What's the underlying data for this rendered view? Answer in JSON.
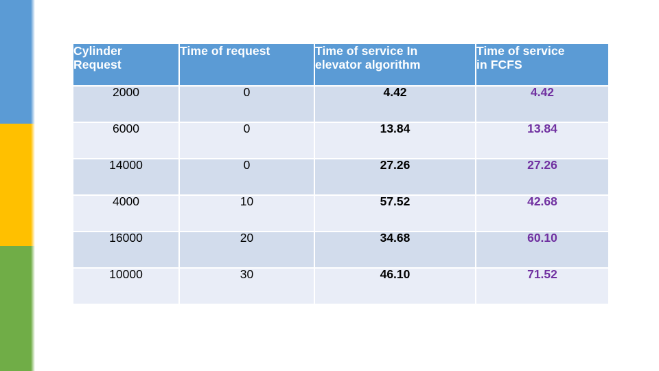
{
  "accent_bar": {
    "segments": [
      {
        "name": "blue-segment",
        "color": "#5B9BD5"
      },
      {
        "name": "yellow-segment",
        "color": "#FFC000"
      },
      {
        "name": "green-segment",
        "color": "#70AD47"
      }
    ]
  },
  "table": {
    "header_bg": "#5B9BD5",
    "header_text_color": "#FFFFFF",
    "band_dark": "#D2DCEC",
    "band_light": "#E9EDF7",
    "fcfs_text_color": "#7030A0",
    "columns": [
      "Cylinder Request",
      "Time of request",
      "Time of service In elevator algorithm",
      "Time of service in FCFS"
    ],
    "header_lines": [
      [
        "Cylinder",
        "Request"
      ],
      [
        "Time of request"
      ],
      [
        "Time of service In",
        "elevator algorithm"
      ],
      [
        "Time of service",
        "in FCFS"
      ]
    ],
    "rows": [
      {
        "cylinder_request": "2000",
        "time_of_request": "0",
        "elevator": "4.42",
        "fcfs": "4.42"
      },
      {
        "cylinder_request": "6000",
        "time_of_request": "0",
        "elevator": "13.84",
        "fcfs": "13.84"
      },
      {
        "cylinder_request": "14000",
        "time_of_request": "0",
        "elevator": "27.26",
        "fcfs": "27.26"
      },
      {
        "cylinder_request": "4000",
        "time_of_request": "10",
        "elevator": "57.52",
        "fcfs": "42.68"
      },
      {
        "cylinder_request": "16000",
        "time_of_request": "20",
        "elevator": "34.68",
        "fcfs": "60.10"
      },
      {
        "cylinder_request": "10000",
        "time_of_request": "30",
        "elevator": "46.10",
        "fcfs": "71.52"
      }
    ]
  }
}
